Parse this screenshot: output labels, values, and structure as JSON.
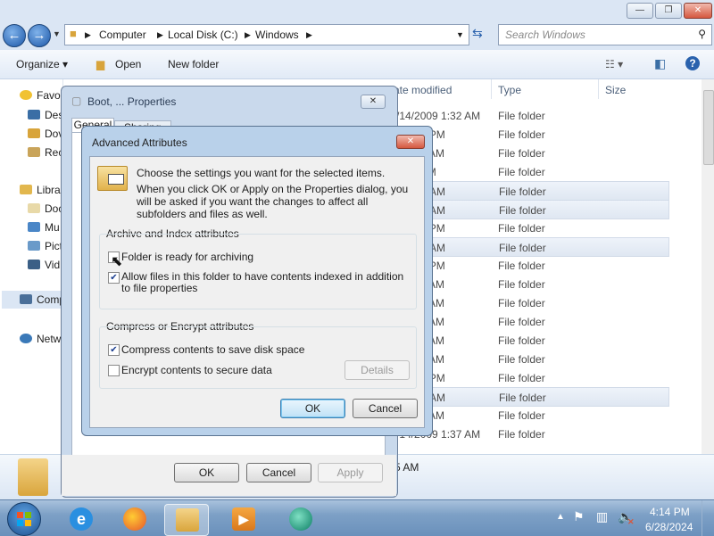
{
  "explorer": {
    "breadcrumb": [
      "Computer",
      "Local Disk (C:)",
      "Windows"
    ],
    "search_placeholder": "Search Windows",
    "toolbar": {
      "organize": "Organize",
      "open": "Open",
      "new_folder": "New folder"
    },
    "nav_items": [
      "Favo",
      "Des",
      "Dov",
      "Rec",
      "Libra",
      "Doc",
      "Mu",
      "Pict",
      "Vid",
      "Comp",
      "Netw"
    ],
    "columns": {
      "date": "ate modified",
      "type": "Type",
      "size": "Size"
    },
    "rows": [
      {
        "date": "/14/2009 1:32 AM",
        "type": "File folder",
        "sel": false
      },
      {
        "date": "3 3:26 PM",
        "type": "File folder",
        "sel": false
      },
      {
        "date": "3 1:03 AM",
        "type": "File folder",
        "sel": false
      },
      {
        "date": "4:22 PM",
        "type": "File folder",
        "sel": false
      },
      {
        "date": "9 1:32 AM",
        "type": "File folder",
        "sel": true
      },
      {
        "date": "9 1:32 AM",
        "type": "File folder",
        "sel": true
      },
      {
        "date": "3 7:16 PM",
        "type": "File folder",
        "sel": false
      },
      {
        "date": "9 1:32 AM",
        "type": "File folder",
        "sel": true
      },
      {
        "date": "3 3:58 PM",
        "type": "File folder",
        "sel": false
      },
      {
        "date": "3 2:09 AM",
        "type": "File folder",
        "sel": false
      },
      {
        "date": "9 1:37 AM",
        "type": "File folder",
        "sel": false
      },
      {
        "date": "9 1:32 AM",
        "type": "File folder",
        "sel": false
      },
      {
        "date": "3 1:02 AM",
        "type": "File folder",
        "sel": false
      },
      {
        "date": "1 3:38 AM",
        "type": "File folder",
        "sel": false
      },
      {
        "date": "4 4:13 PM",
        "type": "File folder",
        "sel": false
      },
      {
        "date": "1 3:46 AM",
        "type": "File folder",
        "sel": true
      },
      {
        "date": "1 3:38 AM",
        "type": "File folder",
        "sel": false
      },
      {
        "date": "/14/2009 1:37 AM",
        "type": "File folder",
        "sel": false
      }
    ],
    "details_time": "5 AM"
  },
  "properties": {
    "title": "Boot, ... Properties",
    "tab_general": "General",
    "tab_sharing": "Sharing",
    "ok": "OK",
    "cancel": "Cancel",
    "apply": "Apply"
  },
  "advanced": {
    "title": "Advanced Attributes",
    "intro": "Choose the settings you want for the selected items.",
    "intro2": "When you click OK or Apply on the Properties dialog, you will be asked if you want the changes to affect all subfolders and files as well.",
    "archive_group": "Archive and Index attributes",
    "archive_label": "Folder is ready for archiving",
    "index_label": "Allow files in this folder to have contents indexed in addition to file properties",
    "compress_group": "Compress or Encrypt attributes",
    "compress_label": "Compress contents to save disk space",
    "encrypt_label": "Encrypt contents to secure data",
    "details": "Details",
    "ok": "OK",
    "cancel": "Cancel",
    "checked": {
      "archive": false,
      "index": true,
      "compress": true,
      "encrypt": false
    }
  },
  "taskbar": {
    "time": "4:14 PM",
    "date": "6/28/2024"
  },
  "colors": {
    "accent": "#1c57a8",
    "selection": "#dfe7f2",
    "close": "#d5583f"
  }
}
